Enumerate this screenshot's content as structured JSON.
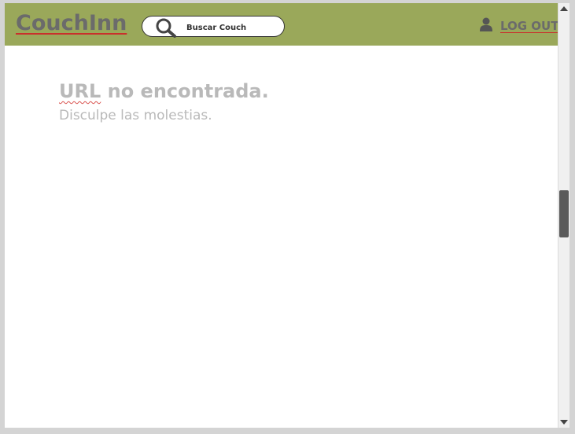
{
  "header": {
    "brand": "CouchInn",
    "search_placeholder": "Buscar Couch",
    "logout_label": "LOG OUT"
  },
  "main": {
    "error_title_prefix": "URL",
    "error_title_rest": " no encontrada.",
    "error_subtitle": "Disculpe las molestias."
  },
  "colors": {
    "navbar": "#9aa85a",
    "brand_text": "#6b6b6b",
    "error_text": "#b9b9b9",
    "spellcheck_underline": "#c9302c"
  },
  "icons": {
    "search": "search-icon",
    "user": "user-icon"
  },
  "scrollbar": {
    "scroll_position": 0.45
  }
}
